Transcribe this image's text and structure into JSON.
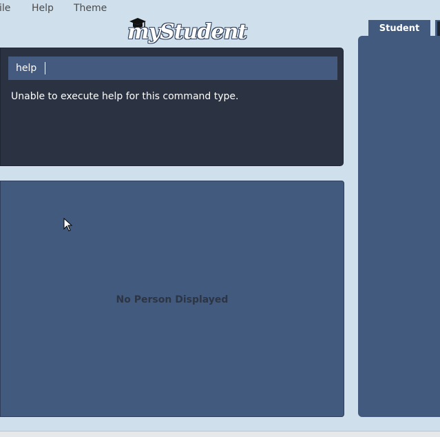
{
  "menu": {
    "file_label": "ile",
    "help_label": "Help",
    "theme_label": "Theme"
  },
  "logo": {
    "text": "myStudent",
    "icon": "graduation-cap-icon"
  },
  "command": {
    "input_value": "help",
    "result_message": "Unable to execute help for this command type."
  },
  "person_panel": {
    "empty_message": "No Person Displayed"
  },
  "tabs": [
    {
      "label": "Student"
    }
  ],
  "colors": {
    "window_bg": "#cfe0ec",
    "panel_dark": "#2b3241",
    "panel_blue": "#425a7d",
    "input_bg": "#445a7f"
  }
}
